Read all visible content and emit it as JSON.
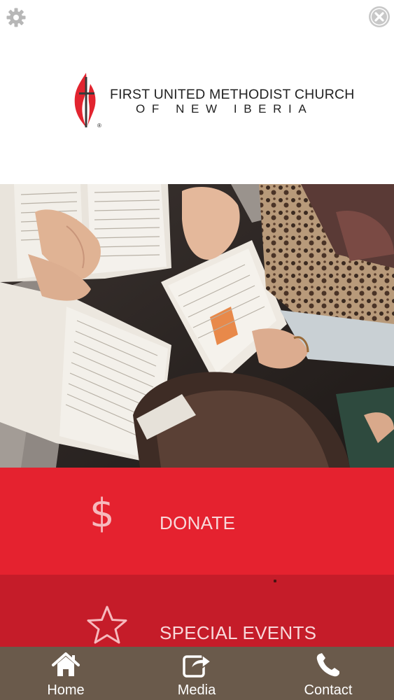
{
  "header": {
    "settings_icon": "gear-icon",
    "close_icon": "close-icon"
  },
  "logo": {
    "line1": "FIRST UNITED METHODIST CHURCH",
    "line2": "OF NEW IBERIA",
    "registered_mark": "®",
    "icon": "cross-and-flame-icon",
    "colors": {
      "flame": "#e2242f",
      "cross": "#3a3a3a"
    }
  },
  "hero": {
    "description_icon": "hero-photo-bible-study"
  },
  "menu": {
    "items": [
      {
        "label": "DONATE",
        "icon": "dollar-icon",
        "symbol": "$",
        "color": "#e5222f"
      },
      {
        "label": "SPECIAL EVENTS",
        "icon": "star-icon",
        "color": "#c51c29"
      }
    ]
  },
  "tabbar": {
    "color": "#6a5a4b",
    "tabs": [
      {
        "label": "Home",
        "icon": "home-icon"
      },
      {
        "label": "Media",
        "icon": "share-icon"
      },
      {
        "label": "Contact",
        "icon": "phone-icon"
      }
    ]
  }
}
